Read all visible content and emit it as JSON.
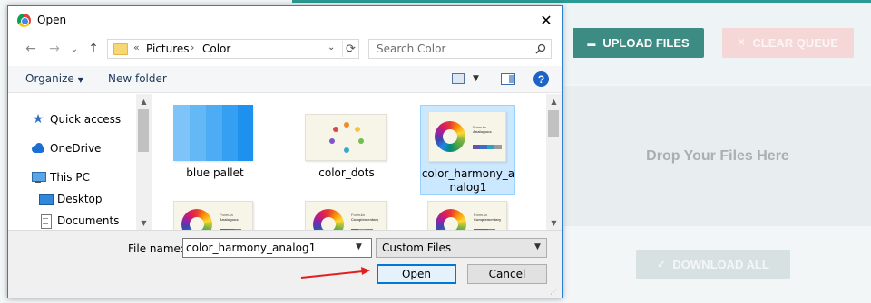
{
  "dialog": {
    "title": "Open",
    "close_glyph": "✕",
    "nav": {
      "back": "←",
      "forward": "→",
      "dropdown": "⌄",
      "up": "↑"
    },
    "address": {
      "overflow": "«",
      "crumbs": [
        "Pictures",
        "Color"
      ],
      "separator": "›",
      "refresh": "⟳"
    },
    "search": {
      "placeholder": "Search Color"
    },
    "toolbar": {
      "organize": "Organize",
      "new_folder": "New folder",
      "help": "?"
    },
    "nav_pane": {
      "items": [
        {
          "label": "Quick access",
          "icon": "star-icon"
        },
        {
          "label": "OneDrive",
          "icon": "cloud-icon"
        },
        {
          "label": "This PC",
          "icon": "pc-icon"
        },
        {
          "label": "Desktop",
          "icon": "desktop-icon"
        },
        {
          "label": "Documents",
          "icon": "documents-icon"
        }
      ]
    },
    "files": [
      {
        "name": "blue pallet",
        "selected": false
      },
      {
        "name": "color_dots",
        "selected": false
      },
      {
        "name": "color_harmony_analog1",
        "name_line1": "color_harmony_a",
        "name_line2": "nalog1",
        "selected": true
      },
      {
        "name": "",
        "thumb_title": "Formula",
        "thumb_subtitle": "Analogous"
      },
      {
        "name": "",
        "thumb_title": "Formula",
        "thumb_subtitle": "Complementary"
      },
      {
        "name": "",
        "thumb_title": "Formula",
        "thumb_subtitle": "Complementary"
      }
    ],
    "thumb_selected": {
      "title": "Formula",
      "subtitle": "Analogous"
    },
    "bottom": {
      "file_name_label": "File name:",
      "file_name_value": "color_harmony_analog1",
      "file_type": "Custom Files",
      "open_label": "Open",
      "cancel_label": "Cancel"
    },
    "scroll_up": "▲",
    "scroll_down": "▼"
  },
  "app": {
    "upload_label": "UPLOAD FILES",
    "clear_label": "CLEAR QUEUE",
    "drop_text": "Drop Your Files Here",
    "download_label": "DOWNLOAD ALL",
    "upload_icon": "▬",
    "clear_icon": "✕",
    "download_icon": "✓"
  },
  "colors": {
    "accent": "#2a9a92",
    "selection": "#cce8ff",
    "annotation_arrow": "#e02020"
  }
}
